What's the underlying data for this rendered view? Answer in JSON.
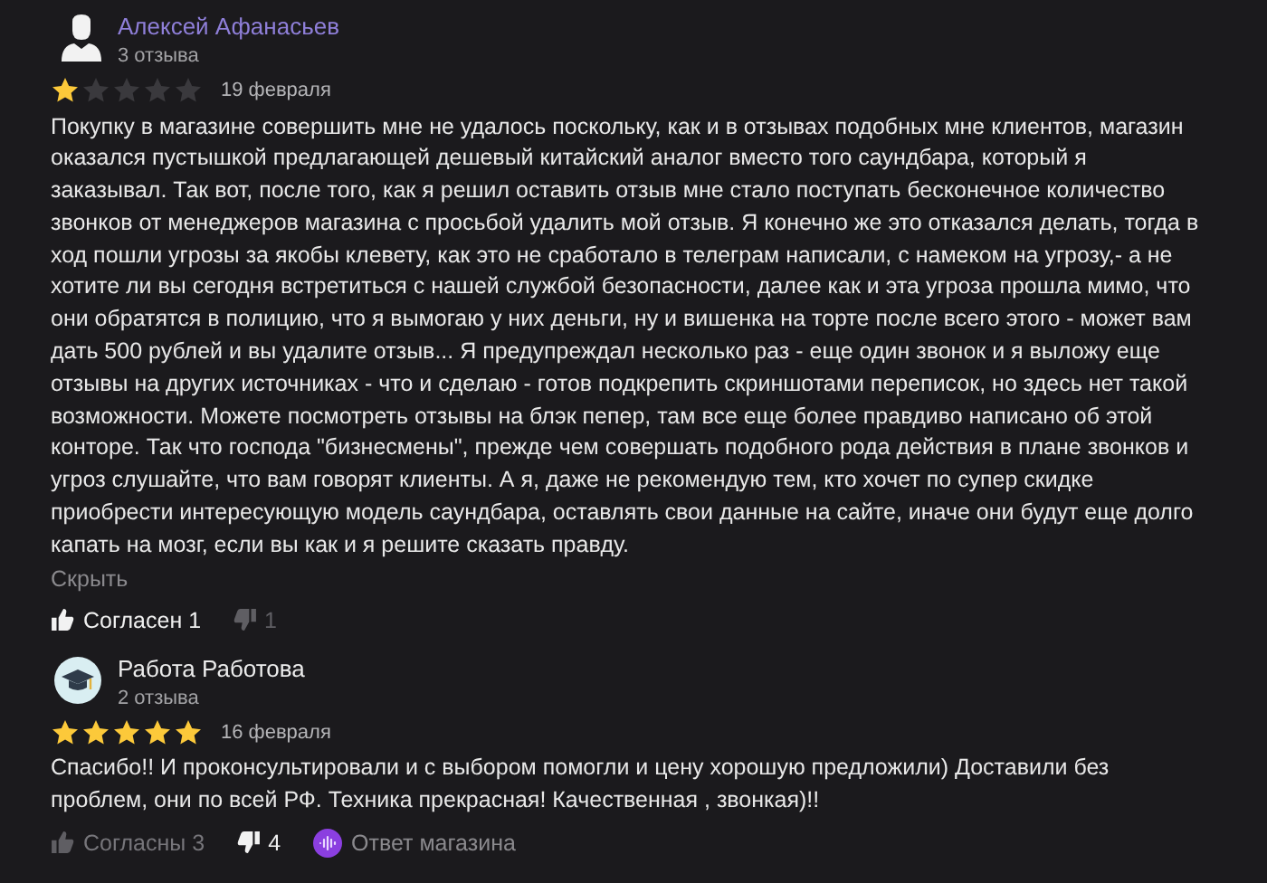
{
  "reviews": [
    {
      "author": "Алексей Афанасьев",
      "avatar": {
        "kind": "person"
      },
      "author_highlighted": true,
      "count": "3 отзыва",
      "stars": 1,
      "date": "19 февраля",
      "text": "Покупку в магазине совершить мне не удалось поскольку, как и в отзывах подобных мне клиентов, магазин оказался пустышкой предлагающей дешевый китайский аналог вместо того саундбара, который я заказывал. Так вот, после того, как я решил оставить отзыв мне стало поступать бесконечное количество звонков от менеджеров магазина с просьбой удалить мой отзыв. Я конечно же это отказался делать, тогда в ход пошли угрозы за якобы клевету, как это не сработало в телеграм написали, с намеком на угрозу,- а не хотите ли вы сегодня встретиться с нашей службой безопасности, далее как и эта угроза прошла мимо, что они обратятся в полицию, что я вымогаю у них деньги, ну и вишенка на торте после всего этого - может вам дать 500 рублей и вы удалите отзыв... Я предупреждал несколько раз - еще один звонок и я выложу еще отзывы на других источниках - что и сделаю - готов подкрепить скриншотами переписок, но здесь нет такой возможности. Можете посмотреть отзывы на блэк пепер, там все еще более правдиво написано об этой конторе. Так что господа \"бизнесмены\", прежде чем совершать подобного рода действия в плане звонков и угроз слушайте, что вам говорят клиенты. А я, даже не рекомендую тем, кто хочет по супер скидке приобрести интересующую модель саундбара, оставлять свои данные на сайте, иначе они будут еще долго капать на мозг, если вы как и я решите сказать правду.",
      "hide_link": "Скрыть",
      "agree": {
        "label": "Согласен 1",
        "selected": true
      },
      "disagree": {
        "label": "1",
        "selected": false
      }
    },
    {
      "author": "Работа Работова",
      "avatar": {
        "kind": "graduate"
      },
      "author_highlighted": false,
      "count": "2 отзыва",
      "stars": 5,
      "date": "16 февраля",
      "text": "Спасибо!! И проконсультировали и с выбором помогли и цену хорошую предложили) Доставили без проблем, они по всей РФ. Техника прекрасная! Качественная , звонкая)!!",
      "agree": {
        "label": "Согласны 3",
        "selected": false
      },
      "disagree": {
        "label": "4",
        "selected": true
      },
      "shop_reply": "Ответ магазина"
    }
  ]
}
